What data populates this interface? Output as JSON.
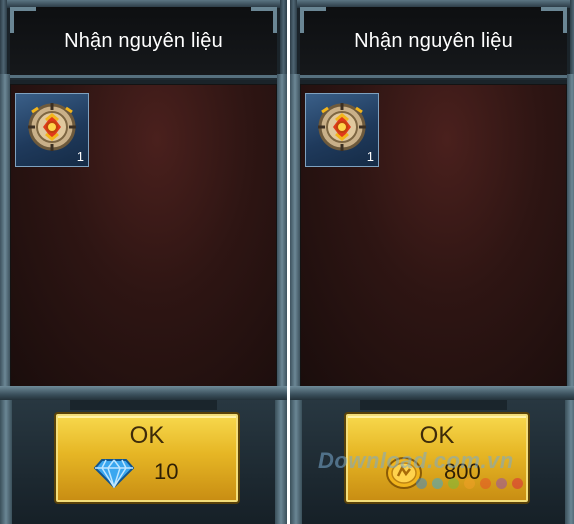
{
  "panels": [
    {
      "title": "Nhận nguyên liệu",
      "item": {
        "icon": "gear-rune-icon",
        "count": "1"
      },
      "button": {
        "label": "OK",
        "cost_icon": "diamond-icon",
        "cost_value": "10"
      }
    },
    {
      "title": "Nhận nguyên liệu",
      "item": {
        "icon": "gear-rune-icon",
        "count": "1"
      },
      "button": {
        "label": "OK",
        "cost_icon": "gold-coin-icon",
        "cost_value": "800"
      }
    }
  ],
  "watermark": {
    "text": "Download.com.vn",
    "logo": "download-watermark-logo"
  },
  "colors": {
    "accent_gold": "#e6b625",
    "frame_steel": "#5b7583",
    "content_bg": "#2e1513",
    "diamond_blue": "#3aa7f0",
    "coin_gold": "#f2b51c"
  }
}
